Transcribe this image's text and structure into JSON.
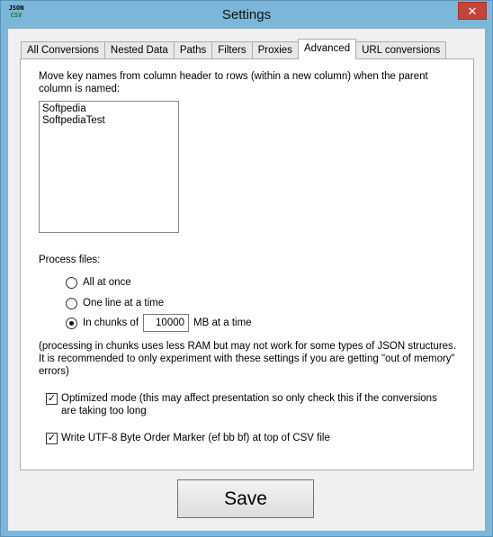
{
  "window": {
    "title": "Settings",
    "icon_text_top": "JSON",
    "icon_text_bottom": "CSV",
    "close_label": "✕"
  },
  "tabs": [
    {
      "label": "All Conversions"
    },
    {
      "label": "Nested Data"
    },
    {
      "label": "Paths"
    },
    {
      "label": "Filters"
    },
    {
      "label": "Proxies"
    },
    {
      "label": "Advanced",
      "active": true
    },
    {
      "label": "URL conversions"
    }
  ],
  "advanced": {
    "move_keys_label": "Move key names from column header to rows (within a new column) when the parent column is named:",
    "key_names": [
      "Softpedia",
      "SoftpediaTest"
    ],
    "process_files_label": "Process files:",
    "radio_all": "All at once",
    "radio_line": "One line at a time",
    "radio_chunks": "In chunks of",
    "chunk_size": "10000",
    "chunk_unit": "MB at a time",
    "note": "(processing in chunks uses less RAM but may not work for some types of JSON structures.  It is recommended to only experiment with these settings if you are getting \"out of memory\" errors)",
    "optimized_label": "Optimized mode (this may affect presentation so only check this if the conversions are taking too long",
    "bom_label": "Write UTF-8 Byte Order Marker (ef bb bf) at top of CSV file",
    "check_mark": "✓"
  },
  "footer": {
    "save_label": "Save"
  }
}
